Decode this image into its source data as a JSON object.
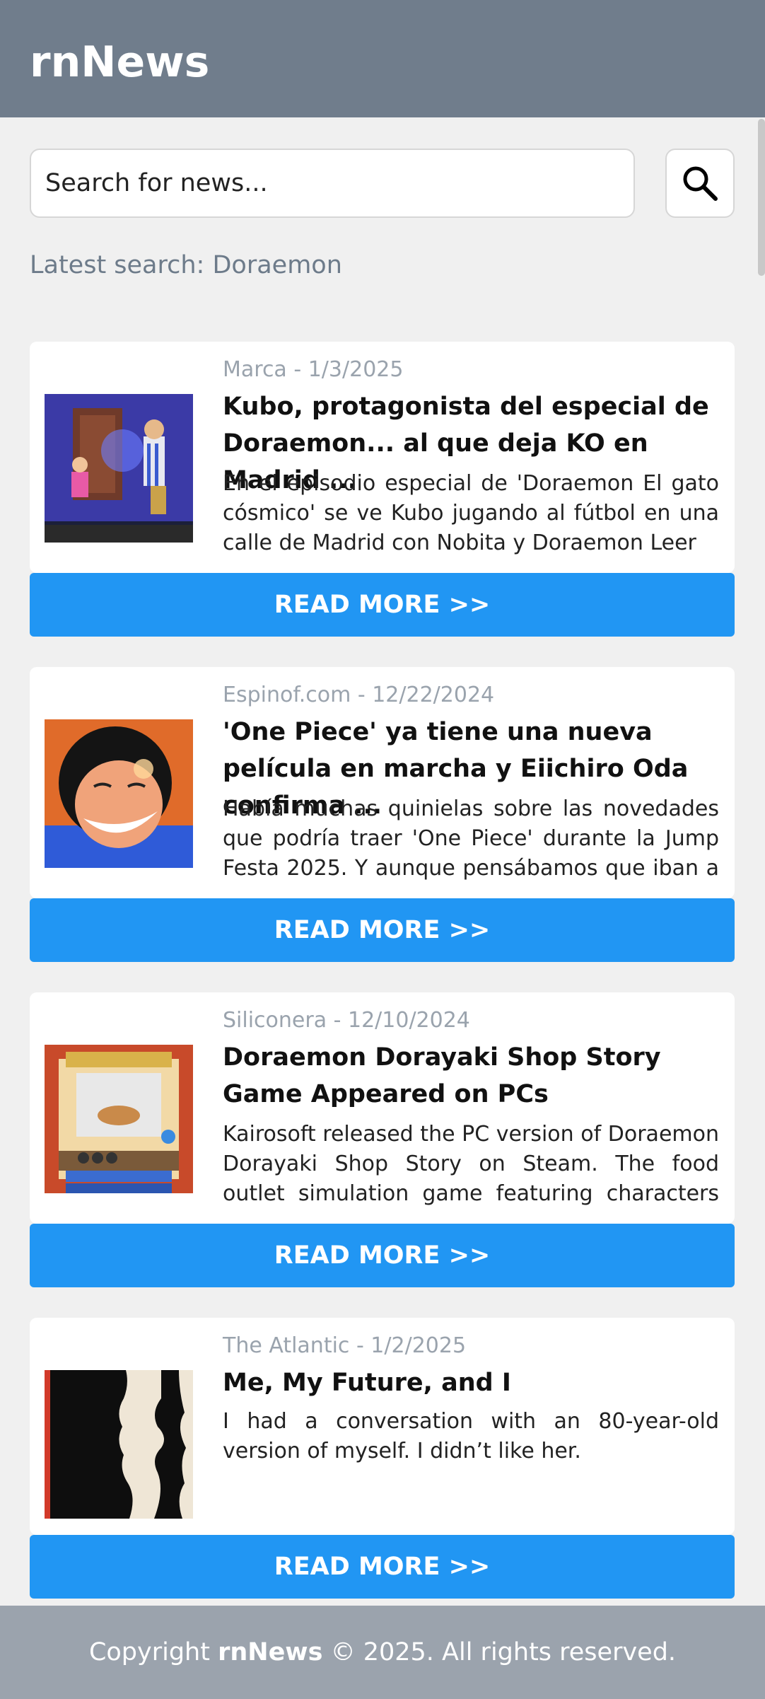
{
  "app": {
    "title": "rnNews"
  },
  "search": {
    "placeholder": "Search for news...",
    "button_icon": "search-icon"
  },
  "latest_search": "Latest search: Doraemon",
  "articles": [
    {
      "source_date": "Marca - 1/3/2025",
      "title": "Kubo, protagonista del especial de Doraemon... al que deja KO en Madrid ...",
      "description": "En el episodio especial de 'Doraemon El gato cósmico' se ve Kubo jugando al fútbol en una calle de Madrid con Nobita y Doraemon  Leer",
      "read_more": "READ MORE  >>"
    },
    {
      "source_date": "Espinof.com - 12/22/2024",
      "title": "'One Piece' ya tiene una nueva película en marcha y Eiichiro Oda confirma ...",
      "description": "Había muchas quinielas sobre las novedades que podría traer 'One Piece' durante la Jump Festa 2025. Y aunque pensábamos que iban a ca...",
      "read_more": "READ MORE  >>"
    },
    {
      "source_date": "Siliconera - 12/10/2024",
      "title": "Doraemon Dorayaki Shop Story Game Appeared on PCs",
      "description": "Kairosoft released the PC version of Doraemon Dorayaki Shop Story on Steam. The food outlet simulation game featuring characters fro...",
      "read_more": "READ MORE  >>"
    },
    {
      "source_date": "The Atlantic - 1/2/2025",
      "title": "Me, My Future, and I",
      "description": "I had a conversation with an 80-year-old version of myself. I didn’t like her.",
      "read_more": "READ MORE  >>"
    }
  ],
  "footer": {
    "prefix": "Copyright ",
    "brand": "rnNews",
    "suffix": " © 2025. All rights reserved."
  },
  "colors": {
    "header": "#707d8c",
    "accent": "#2196f3",
    "footer": "#9ba3ad",
    "background": "#f0f0f0"
  }
}
